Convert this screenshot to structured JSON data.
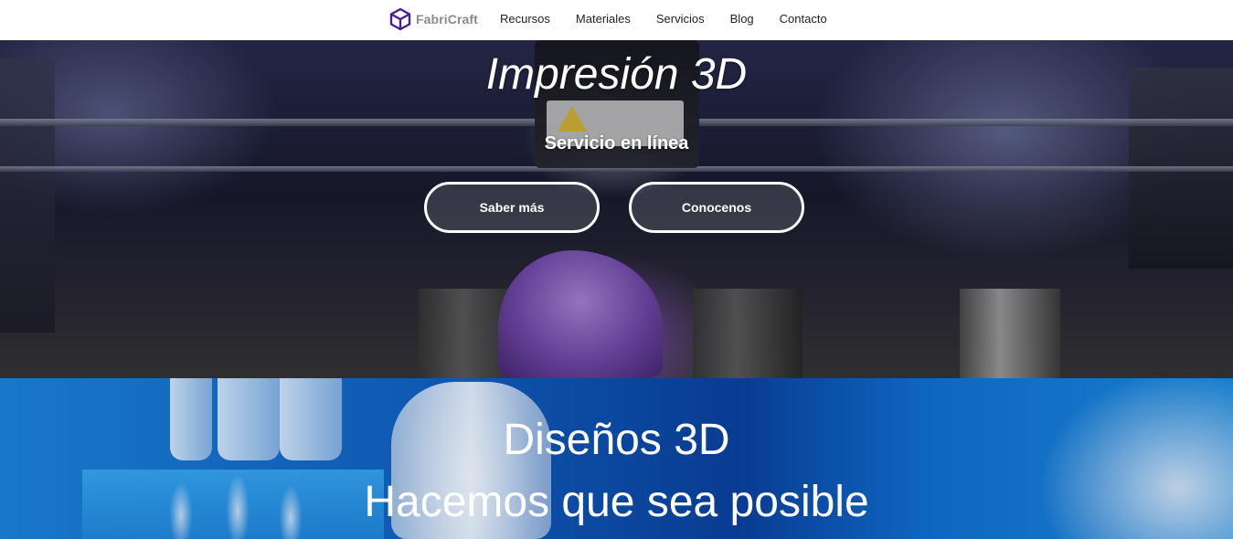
{
  "brand": {
    "name": "FabriCraft",
    "icon": "cube-logo-icon",
    "color": "#4b1d8e"
  },
  "nav": {
    "items": [
      {
        "label": "Recursos"
      },
      {
        "label": "Materiales"
      },
      {
        "label": "Servicios"
      },
      {
        "label": "Blog"
      },
      {
        "label": "Contacto"
      }
    ]
  },
  "hero": {
    "title": "Impresión 3D",
    "subtitle": "Servicio en línea",
    "buttons": [
      {
        "label": "Saber más"
      },
      {
        "label": "Conocenos"
      }
    ],
    "warning_text": "WARNING HOT SURFACE"
  },
  "section2": {
    "title": "Diseños 3D",
    "subtitle": "Hacemos que sea posible"
  }
}
